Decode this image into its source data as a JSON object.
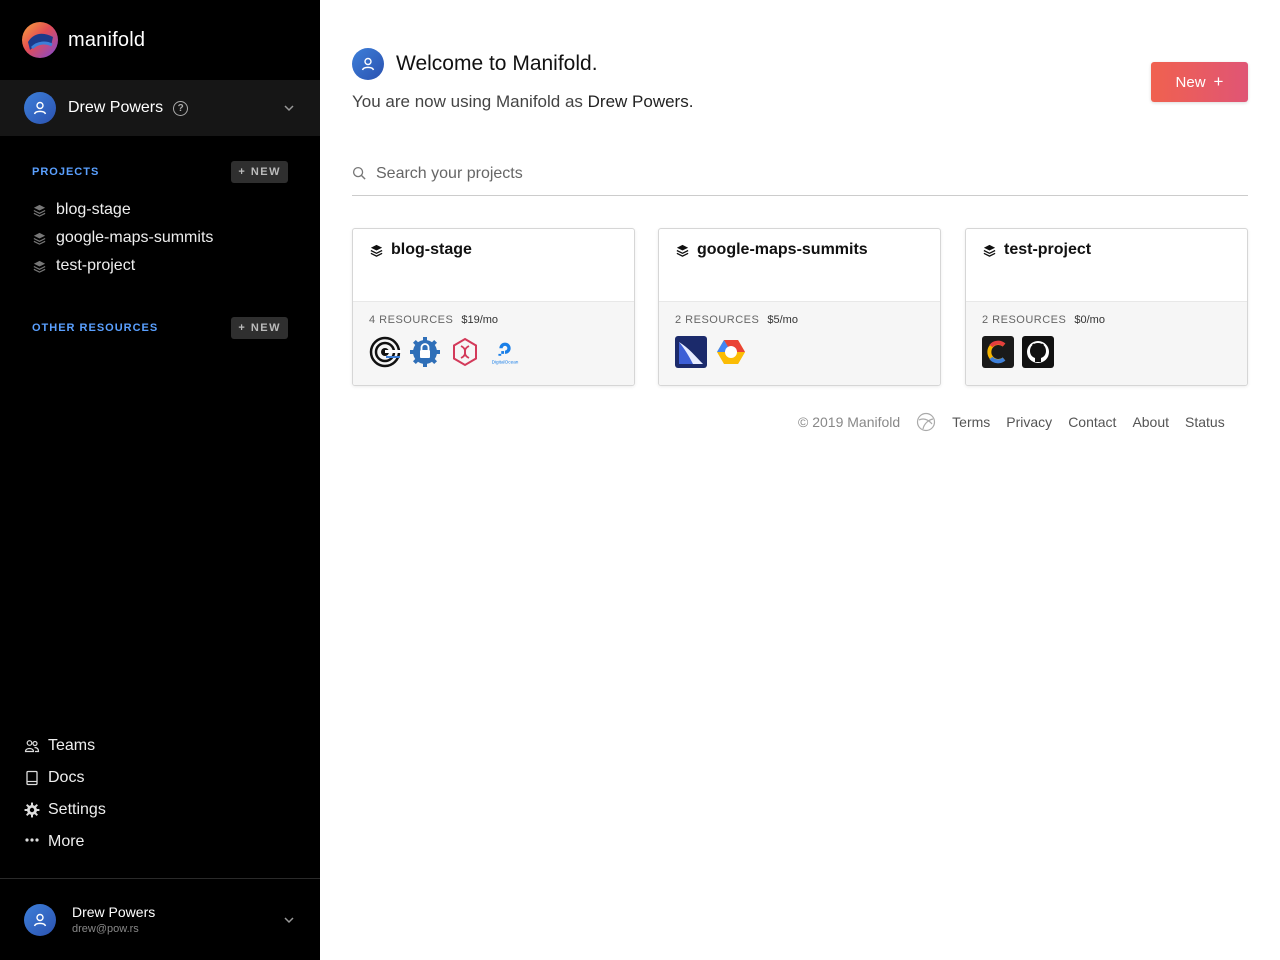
{
  "app": {
    "brand": "manifold"
  },
  "account": {
    "name": "Drew Powers",
    "help": "?"
  },
  "sidebar": {
    "projects_title": "PROJECTS",
    "new_label": "+ NEW",
    "projects": [
      {
        "label": "blog-stage"
      },
      {
        "label": "google-maps-summits"
      },
      {
        "label": "test-project"
      }
    ],
    "other_title": "OTHER RESOURCES",
    "nav": [
      {
        "label": "Teams",
        "icon": "users-icon"
      },
      {
        "label": "Docs",
        "icon": "book-icon"
      },
      {
        "label": "Settings",
        "icon": "gear-icon"
      },
      {
        "label": "More",
        "icon": "ellipsis-icon"
      }
    ]
  },
  "user": {
    "name": "Drew Powers",
    "email": "drew@pow.rs"
  },
  "welcome": {
    "title": "Welcome to Manifold.",
    "sub_prefix": "You are now using Manifold as ",
    "sub_name": "Drew Powers."
  },
  "cta": {
    "label": "New",
    "plus": "+"
  },
  "search": {
    "placeholder": "Search your projects"
  },
  "cards": [
    {
      "title": "blog-stage",
      "resources": "4 RESOURCES",
      "price": "$19/mo",
      "icons": [
        "elephantsql-icon",
        "lock-badge-icon",
        "dna-hexagon-icon",
        "digitalocean-icon"
      ]
    },
    {
      "title": "google-maps-summits",
      "resources": "2 RESOURCES",
      "price": "$5/mo",
      "icons": [
        "sail-icon",
        "google-cloud-icon"
      ]
    },
    {
      "title": "test-project",
      "resources": "2 RESOURCES",
      "price": "$0/mo",
      "icons": [
        "c-logo-icon",
        "github-icon"
      ]
    }
  ],
  "resource_text": {
    "digitalocean": "DigitalOcean"
  },
  "footer": {
    "copyright": "© 2019 Manifold",
    "links": [
      "Terms",
      "Privacy",
      "Contact",
      "About",
      "Status"
    ]
  },
  "colors": {
    "accent": "#5aa0ff",
    "cta_start": "#f0614f",
    "cta_end": "#e05575",
    "sidebar_bg": "#000000"
  }
}
